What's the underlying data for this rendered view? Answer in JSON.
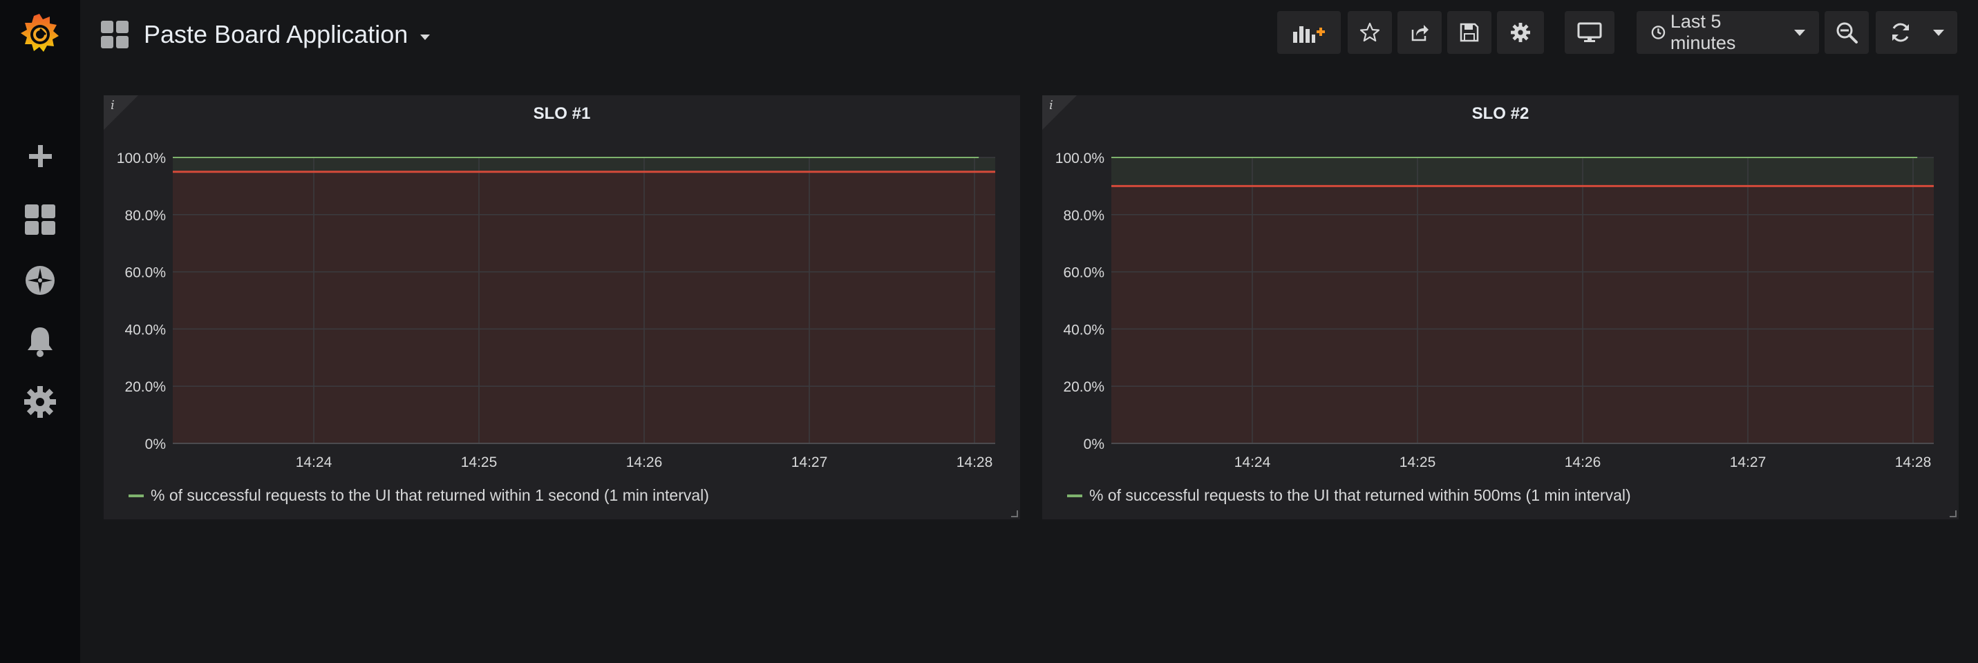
{
  "dashboard": {
    "title": "Paste Board Application"
  },
  "toolbar": {
    "time_range": "Last 5 minutes"
  },
  "sidebar": {
    "items": [
      "grafana-logo",
      "create",
      "dashboards",
      "explore",
      "alerting",
      "configuration"
    ]
  },
  "panels": [
    {
      "title": "SLO #1",
      "info": "i",
      "legend": "% of successful requests to the UI that returned within 1 second (1 min interval)"
    },
    {
      "title": "SLO #2",
      "info": "i",
      "legend": "% of successful requests to the UI that returned within 500ms (1 min interval)"
    }
  ],
  "colors": {
    "series": "#7eb26d",
    "threshold": "#d44a3a",
    "accent": "#f7941e"
  },
  "chart_data": [
    {
      "type": "line",
      "title": "SLO #1",
      "x_ticks": [
        "14:24",
        "14:25",
        "14:26",
        "14:27",
        "14:28"
      ],
      "y_ticks": [
        "0%",
        "20.0%",
        "40.0%",
        "60.0%",
        "80.0%",
        "100.0%"
      ],
      "ylim": [
        0,
        100
      ],
      "series": [
        {
          "name": "% of successful requests to the UI that returned within 1 second (1 min interval)",
          "values": [
            100,
            100,
            100,
            100,
            100,
            100
          ]
        }
      ],
      "threshold": 95,
      "x_end_fraction": 0.98,
      "grid": true,
      "legend_position": "bottom-left"
    },
    {
      "type": "line",
      "title": "SLO #2",
      "x_ticks": [
        "14:24",
        "14:25",
        "14:26",
        "14:27",
        "14:28"
      ],
      "y_ticks": [
        "0%",
        "20.0%",
        "40.0%",
        "60.0%",
        "80.0%",
        "100.0%"
      ],
      "ylim": [
        0,
        100
      ],
      "series": [
        {
          "name": "% of successful requests to the UI that returned within 500ms (1 min interval)",
          "values": [
            100,
            100,
            100,
            100,
            100,
            100
          ]
        }
      ],
      "threshold": 90,
      "x_end_fraction": 0.98,
      "grid": true,
      "legend_position": "bottom-left"
    }
  ]
}
